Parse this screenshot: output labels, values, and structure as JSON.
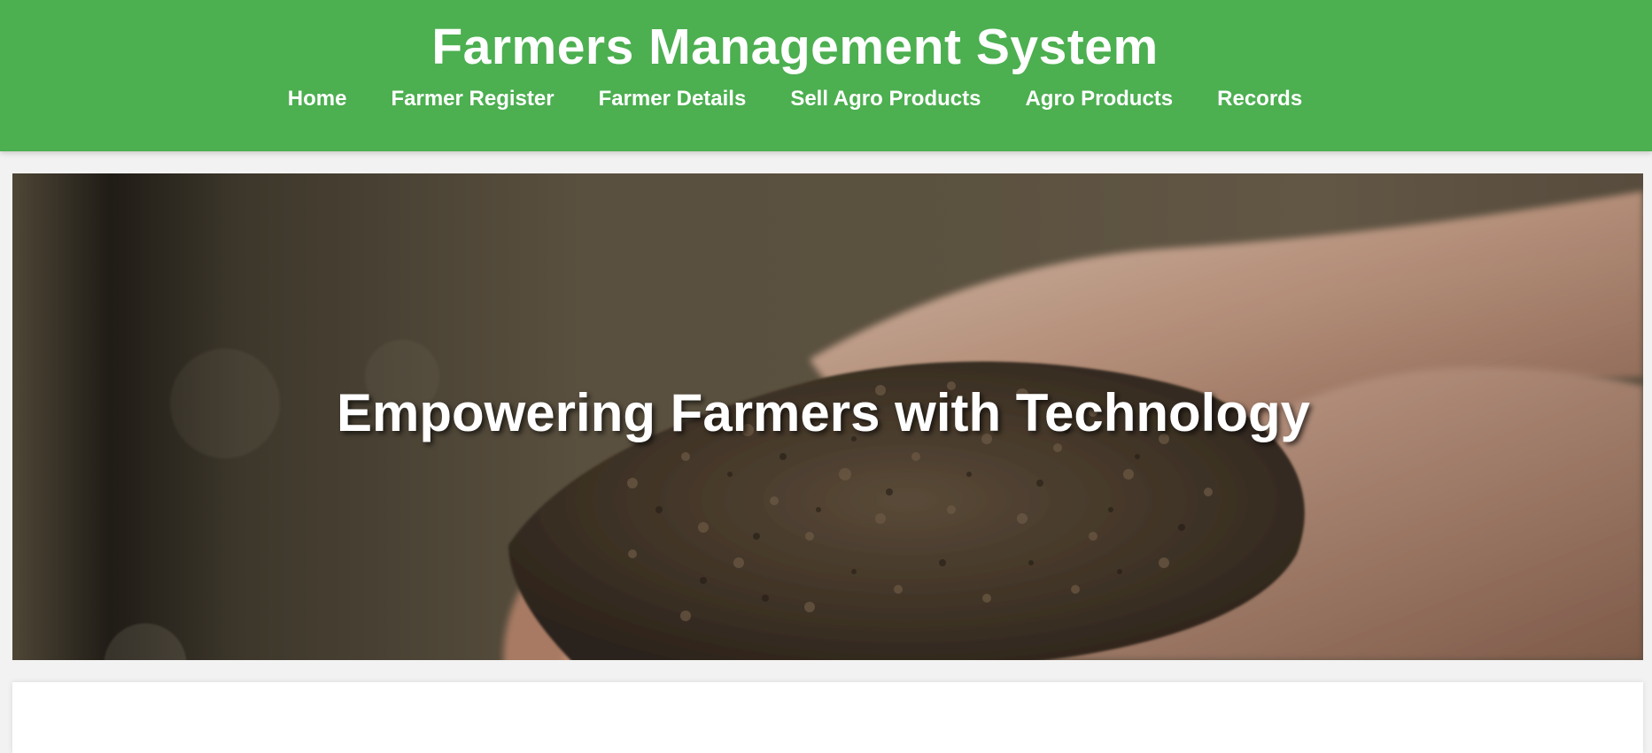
{
  "header": {
    "title": "Farmers Management System",
    "nav": [
      {
        "label": "Home"
      },
      {
        "label": "Farmer Register"
      },
      {
        "label": "Farmer Details"
      },
      {
        "label": "Sell Agro Products"
      },
      {
        "label": "Agro Products"
      },
      {
        "label": "Records"
      }
    ]
  },
  "hero": {
    "heading": "Empowering Farmers with Technology"
  },
  "colors": {
    "brand_green": "#4caf50",
    "page_background": "#f2f2f2",
    "text_on_brand": "#ffffff"
  }
}
